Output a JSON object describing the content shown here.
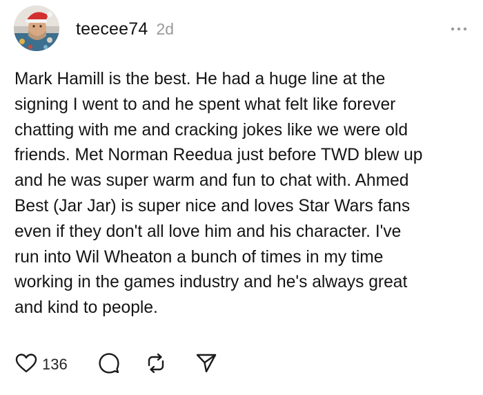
{
  "post": {
    "username": "teecee74",
    "timestamp": "2d",
    "body": "Mark Hamill is the best. He had a huge line at the\nsigning I went to and he spent what felt like forever\nchatting with me and cracking jokes like we were old\nfriends. Met Norman Reedua just before TWD blew up\nand he was super warm and fun to chat with. Ahmed\nBest (Jar Jar) is super nice and loves Star Wars fans\neven if they don't all love him and his character. I've\nrun into Wil Wheaton a bunch of times in my time\nworking in the games industry and he's always great\nand kind to people.",
    "like_count": "136"
  },
  "icons": {
    "more": "more-icon",
    "like": "heart-icon",
    "reply": "comment-icon",
    "repost": "repost-icon",
    "share": "send-icon"
  },
  "colors": {
    "text": "#141414",
    "secondary": "#999999",
    "icon": "#1a1a1a"
  }
}
